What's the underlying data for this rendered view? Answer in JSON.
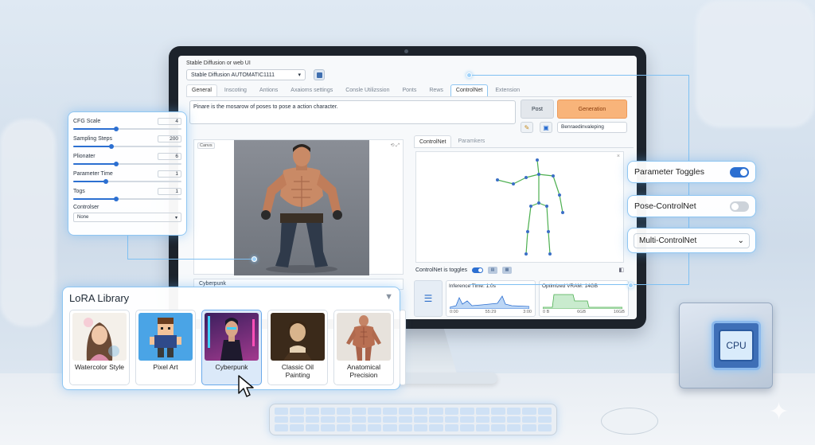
{
  "app": {
    "title": "Stable Diffusion or web UI",
    "model": "Stable Diffusion AUTOMATIC1111"
  },
  "tabs": [
    "General",
    "Inscoting",
    "Antions",
    "Axaioms settings",
    "Consle Utilizssion",
    "Ponts",
    "Rews",
    "ControlNet",
    "Extension"
  ],
  "active_tab": "ControlNet",
  "prompt": {
    "text": "Pinare is the mosarow of poses to pose a action character."
  },
  "buttons": {
    "post": "Post",
    "generate": "Generation"
  },
  "style_field": "Benraedinvaleping",
  "canvas": {
    "label": "Canvs"
  },
  "style_bar": "Cyberpunk",
  "controlnet": {
    "sub_tabs": [
      "ControlNet",
      "Paramkers"
    ],
    "toggle_label": "ControlNet is toggles"
  },
  "stats": {
    "inference": {
      "title": "Inference Time: 1.0s",
      "axis": [
        "0:00",
        "55:29",
        "3:00"
      ]
    },
    "vram": {
      "title": "Optimized VRAM: 14GB",
      "axis": [
        "0 B",
        "6GB",
        "16GB"
      ]
    }
  },
  "params": [
    {
      "label": "CFG Scale",
      "value": "4",
      "fill": 0.4
    },
    {
      "label": "Sampling Steps",
      "value": "200",
      "fill": 0.35
    },
    {
      "label": "Plionater",
      "value": "6",
      "fill": 0.4
    },
    {
      "label": "Parameter Time",
      "value": "1",
      "fill": 0.3
    },
    {
      "label": "Togs",
      "value": "1",
      "fill": 0.4
    }
  ],
  "controlnet_select": {
    "label": "Controlser",
    "value": "None"
  },
  "options": {
    "param_toggles": {
      "label": "Parameter Toggles",
      "on": true
    },
    "pose_controlnet": {
      "label": "Pose-ControlNet",
      "on": false
    },
    "multi_controlnet": {
      "label": "Multi-ControlNet"
    }
  },
  "lora": {
    "title": "LoRA Library",
    "items": [
      {
        "label": "Watercolor Style"
      },
      {
        "label": "Pixel Art"
      },
      {
        "label": "Cyberpunk",
        "selected": true
      },
      {
        "label": "Classic Oil Painting"
      },
      {
        "label": "Anatomical Precision"
      }
    ]
  },
  "hardware": {
    "cpu_label": "CPU"
  },
  "colors": {
    "accent": "#2c6fd1",
    "generate": "#f8b47a",
    "glow": "#8fc6f2"
  }
}
